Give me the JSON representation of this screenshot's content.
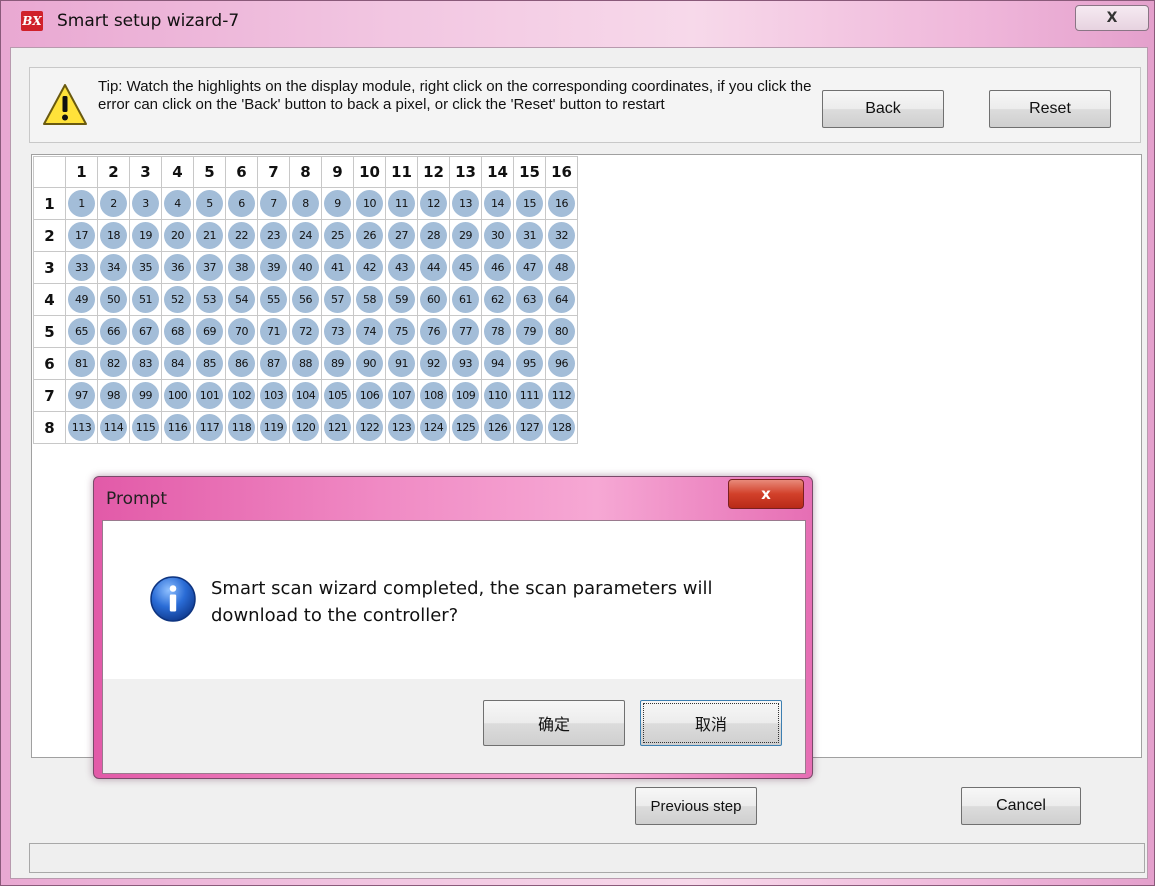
{
  "window": {
    "title": "Smart setup wizard-7",
    "app_icon_text": "BX",
    "close_glyph": "X"
  },
  "tip": {
    "text": "Tip: Watch the highlights on the display module, right click on the corresponding coordinates, if you click the error can click on the 'Back' button to back a pixel, or click the 'Reset' button to restart",
    "back_label": "Back",
    "reset_label": "Reset"
  },
  "grid": {
    "columns": [
      "1",
      "2",
      "3",
      "4",
      "5",
      "6",
      "7",
      "8",
      "9",
      "10",
      "11",
      "12",
      "13",
      "14",
      "15",
      "16"
    ],
    "rows": [
      "1",
      "2",
      "3",
      "4",
      "5",
      "6",
      "7",
      "8"
    ],
    "cells": [
      [
        "1",
        "2",
        "3",
        "4",
        "5",
        "6",
        "7",
        "8",
        "9",
        "10",
        "11",
        "12",
        "13",
        "14",
        "15",
        "16"
      ],
      [
        "17",
        "18",
        "19",
        "20",
        "21",
        "22",
        "23",
        "24",
        "25",
        "26",
        "27",
        "28",
        "29",
        "30",
        "31",
        "32"
      ],
      [
        "33",
        "34",
        "35",
        "36",
        "37",
        "38",
        "39",
        "40",
        "41",
        "42",
        "43",
        "44",
        "45",
        "46",
        "47",
        "48"
      ],
      [
        "49",
        "50",
        "51",
        "52",
        "53",
        "54",
        "55",
        "56",
        "57",
        "58",
        "59",
        "60",
        "61",
        "62",
        "63",
        "64"
      ],
      [
        "65",
        "66",
        "67",
        "68",
        "69",
        "70",
        "71",
        "72",
        "73",
        "74",
        "75",
        "76",
        "77",
        "78",
        "79",
        "80"
      ],
      [
        "81",
        "82",
        "83",
        "84",
        "85",
        "86",
        "87",
        "88",
        "89",
        "90",
        "91",
        "92",
        "93",
        "94",
        "95",
        "96"
      ],
      [
        "97",
        "98",
        "99",
        "100",
        "101",
        "102",
        "103",
        "104",
        "105",
        "106",
        "107",
        "108",
        "109",
        "110",
        "111",
        "112"
      ],
      [
        "113",
        "114",
        "115",
        "116",
        "117",
        "118",
        "119",
        "120",
        "121",
        "122",
        "123",
        "124",
        "125",
        "126",
        "127",
        "128"
      ]
    ],
    "highlight_color": "#a3bdd8"
  },
  "footer": {
    "previous_label": "Previous step",
    "cancel_label": "Cancel"
  },
  "prompt": {
    "title": "Prompt",
    "close_glyph": "x",
    "message": "Smart scan wizard completed, the scan parameters will download to the controller?",
    "ok_label": "确定",
    "cancel_label": "取消"
  }
}
